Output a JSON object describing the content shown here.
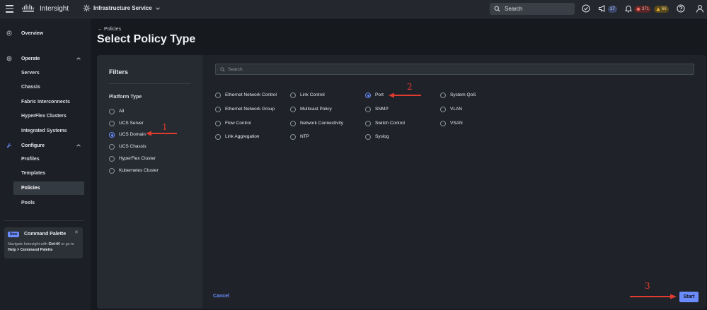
{
  "topbar": {
    "brand": "Intersight",
    "service": "Infrastructure Service",
    "search_placeholder": "Search",
    "announcements_count": "17",
    "critical_count": "371",
    "warning_count": "66"
  },
  "sidebar": {
    "overview": "Overview",
    "operate": "Operate",
    "operate_items": [
      "Servers",
      "Chassis",
      "Fabric Interconnects",
      "HyperFlex Clusters",
      "Integrated Systems"
    ],
    "configure": "Configure",
    "configure_items": [
      "Profiles",
      "Templates",
      "Policies",
      "Pools"
    ],
    "active_item": "Policies",
    "command_palette": {
      "badge": "New",
      "title": "Command Palette",
      "desc_pre": "Navigate Intersight with ",
      "shortcut": "Ctrl+K",
      "desc_mid": " or go to ",
      "help_path": "Help > Command Palette"
    }
  },
  "page": {
    "breadcrumb": "Policies",
    "title": "Select Policy Type"
  },
  "filters": {
    "title": "Filters",
    "platform_label": "Platform Type",
    "options": [
      "All",
      "UCS Server",
      "UCS Domain",
      "UCS Chassis",
      "HyperFlex Cluster",
      "Kubernetes Cluster"
    ],
    "selected": "UCS Domain"
  },
  "policy": {
    "search_placeholder": "Search",
    "columns": [
      [
        "Ethernet Network Control",
        "Ethernet Network Group",
        "Flow Control",
        "Link Aggregation"
      ],
      [
        "Link Control",
        "Multicast Policy",
        "Network Connectivity",
        "NTP"
      ],
      [
        "Port",
        "SNMP",
        "Switch Control",
        "Syslog"
      ],
      [
        "System QoS",
        "VLAN",
        "VSAN"
      ]
    ],
    "selected": "Port"
  },
  "actions": {
    "cancel": "Cancel",
    "start": "Start"
  },
  "annotations": {
    "step1": "1",
    "step2": "2",
    "step3": "3",
    "color": "#e23b2f"
  }
}
